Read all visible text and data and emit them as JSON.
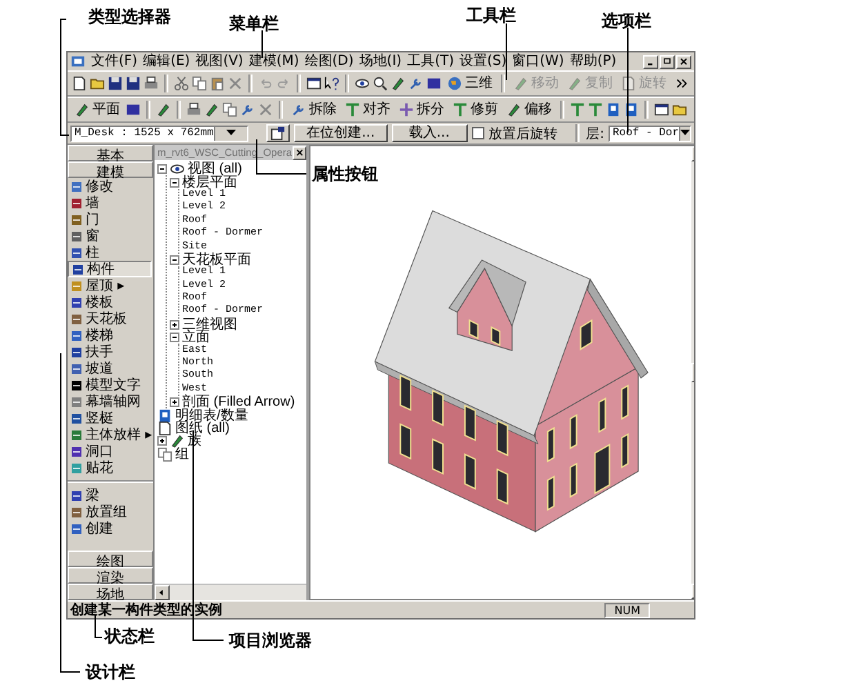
{
  "annotations": [
    {
      "text": "类型选择器"
    },
    {
      "text": "菜单栏"
    },
    {
      "text": "工具栏"
    },
    {
      "text": "选项栏"
    },
    {
      "text": "属性按钮"
    },
    {
      "text": "状态栏"
    },
    {
      "text": "项目浏览器"
    },
    {
      "text": "设计栏"
    }
  ],
  "menu": [
    "文件(F)",
    "编辑(E)",
    "视图(V)",
    "建模(M)",
    "绘图(D)",
    "场地(I)",
    "工具(T)",
    "设置(S)",
    "窗口(W)",
    "帮助(P)"
  ],
  "toolbar": {
    "buttons": [
      {
        "label": "三维",
        "disabled": false
      },
      {
        "label": "移动",
        "disabled": true
      },
      {
        "label": "复制",
        "disabled": true
      },
      {
        "label": "旋转",
        "disabled": true
      }
    ]
  },
  "edit_toolbar": {
    "buttons": [
      {
        "label": "平面"
      },
      {
        "label": "拆除"
      },
      {
        "label": "对齐"
      },
      {
        "label": "拆分"
      },
      {
        "label": "修剪"
      },
      {
        "label": "偏移"
      }
    ]
  },
  "options_bar": {
    "type_selector": "M_Desk : 1525 x 762mm",
    "buttons": [
      "在位创建...",
      "载入..."
    ],
    "checkbox": {
      "label": "放置后旋转",
      "checked": false
    },
    "level_label": "层:",
    "level_value": "Roof - Dor"
  },
  "design_bar": {
    "top_tabs": [
      "基本"
    ],
    "active_tab": "建模",
    "groups": [
      [
        {
          "label": "修改",
          "selected": false
        },
        {
          "label": "墙",
          "selected": false
        },
        {
          "label": "门",
          "selected": false
        },
        {
          "label": "窗",
          "selected": false
        },
        {
          "label": "柱",
          "selected": false
        },
        {
          "label": "构件",
          "selected": true
        },
        {
          "label": "屋顶 ▸",
          "selected": false
        },
        {
          "label": "楼板",
          "selected": false
        },
        {
          "label": "天花板",
          "selected": false
        },
        {
          "label": "楼梯",
          "selected": false
        },
        {
          "label": "扶手",
          "selected": false
        },
        {
          "label": "坡道",
          "selected": false
        },
        {
          "label": "模型文字",
          "selected": false
        },
        {
          "label": "幕墙轴网",
          "selected": false
        },
        {
          "label": "竖梃",
          "selected": false
        },
        {
          "label": "主体放样 ▸",
          "selected": false
        },
        {
          "label": "洞口",
          "selected": false
        },
        {
          "label": "贴花",
          "selected": false
        }
      ],
      [
        {
          "label": "梁",
          "selected": false
        },
        {
          "label": "放置组",
          "selected": false
        },
        {
          "label": "创建",
          "selected": false
        }
      ]
    ],
    "bottom_tabs": [
      "绘图",
      "渲染",
      "场地"
    ]
  },
  "project_browser": {
    "title": "m_rvt6_WSC_Cutting_Opera",
    "tree": [
      {
        "label": "视图 (all)",
        "expanded": true,
        "children": [
          {
            "label": "楼层平面",
            "expanded": true,
            "children": [
              {
                "label": "Level 1"
              },
              {
                "label": "Level 2"
              },
              {
                "label": "Roof"
              },
              {
                "label": "Roof - Dormer"
              },
              {
                "label": "Site"
              }
            ]
          },
          {
            "label": "天花板平面",
            "expanded": true,
            "children": [
              {
                "label": "Level 1"
              },
              {
                "label": "Level 2"
              },
              {
                "label": "Roof"
              },
              {
                "label": "Roof - Dormer"
              }
            ]
          },
          {
            "label": "三维视图",
            "expanded": false
          },
          {
            "label": "立面",
            "expanded": true,
            "children": [
              {
                "label": "East"
              },
              {
                "label": "North"
              },
              {
                "label": "South"
              },
              {
                "label": "West"
              }
            ]
          },
          {
            "label": "剖面 (Filled Arrow)",
            "expanded": false
          }
        ]
      },
      {
        "label": "明细表/数量"
      },
      {
        "label": "图纸 (all)"
      },
      {
        "label": "族",
        "expanded": false
      },
      {
        "label": "组"
      }
    ]
  },
  "status_bar": {
    "message": "创建某一构件类型的实例",
    "indicators": [
      "NUM"
    ]
  }
}
